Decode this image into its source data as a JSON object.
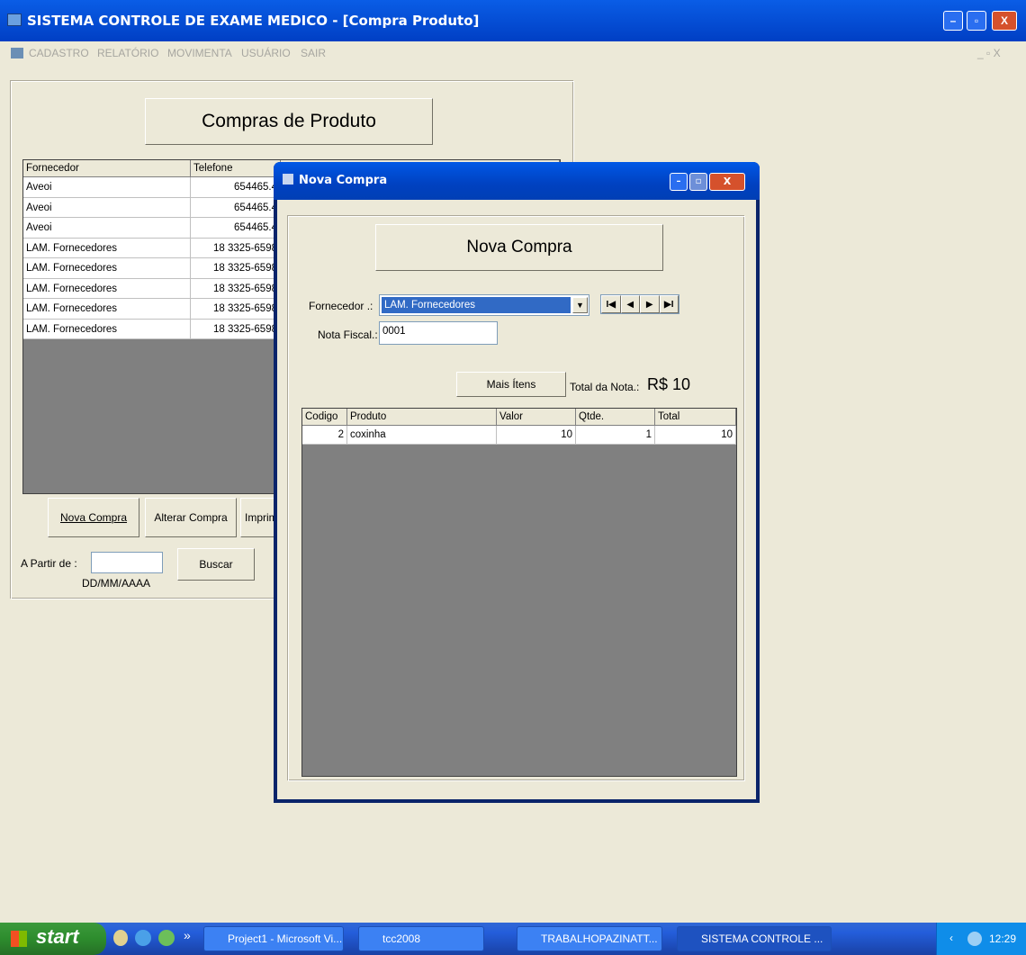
{
  "window": {
    "title": "SISTEMA CONTROLE DE EXAME MEDICO - [Compra Produto]",
    "minimize": "–",
    "maximize": "▫",
    "close": "X"
  },
  "menu": {
    "items": [
      "CADASTRO",
      "RELATÓRIO",
      "MOVIMENTA",
      "USUÁRIO",
      "SAIR"
    ],
    "mdi_controls": "_ ▫ X"
  },
  "compra_produto": {
    "heading": "Compras de Produto",
    "columns": [
      "Fornecedor",
      "Telefone"
    ],
    "rows": [
      [
        "Aveoi",
        "654465.4"
      ],
      [
        "Aveoi",
        "654465.4"
      ],
      [
        "Aveoi",
        "654465.4"
      ],
      [
        "LAM. Fornecedores",
        "18 3325-6598"
      ],
      [
        "LAM. Fornecedores",
        "18 3325-6598"
      ],
      [
        "LAM. Fornecedores",
        "18 3325-6598"
      ],
      [
        "LAM. Fornecedores",
        "18 3325-6598"
      ],
      [
        "LAM. Fornecedores",
        "18 3325-6598"
      ]
    ],
    "buttons": {
      "nova_compra": "Nova Compra",
      "alterar_compra": "Alterar Compra",
      "imprimir": "Imprim"
    },
    "a_partir_label": "A Partir de :",
    "a_partir_value": "",
    "date_format": "DD/MM/AAAA",
    "buscar": "Buscar"
  },
  "dialog": {
    "title": "Nova Compra",
    "heading": "Nova Compra",
    "fornecedor_label": "Fornecedor .:",
    "fornecedor_value": "LAM. Fornecedores",
    "nav": [
      "I◀",
      "◀",
      "▶",
      "▶I"
    ],
    "nota_fiscal_label": "Nota Fiscal.:",
    "nota_fiscal_value": "0001",
    "mais_itens": "Mais Ítens",
    "total_label": "Total da Nota.:",
    "total_value": "R$ 10",
    "columns": [
      "Codigo",
      "Produto",
      "Valor",
      "Qtde.",
      "Total"
    ],
    "rows": [
      [
        "2",
        "coxinha",
        "10",
        "1",
        "10"
      ]
    ]
  },
  "taskbar": {
    "start": "start",
    "tasks": [
      "Project1 - Microsoft Vi...",
      "tcc2008",
      "TRABALHOPAZINATT...",
      "SISTEMA CONTROLE ..."
    ],
    "chevron": "»",
    "clock": "12:29"
  }
}
